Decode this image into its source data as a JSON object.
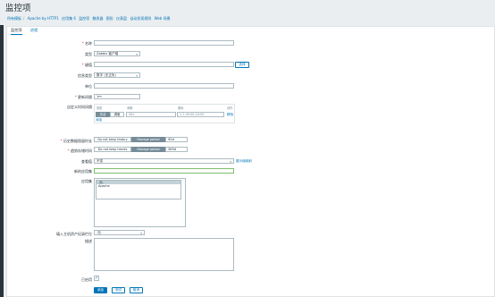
{
  "header": {
    "title": "监控项",
    "breadcrumbs": [
      "所有模板",
      "Apache by HTTP1",
      "应用集 6",
      "监控项",
      "触发器",
      "图形",
      "仪表盘",
      "自动发现规则",
      "Web 场景"
    ]
  },
  "tabs": [
    "监控项",
    "进程"
  ],
  "form": {
    "name_label": "名称",
    "type_label": "类型",
    "type_value": "Zabbix 客户端",
    "key_label": "键值",
    "key_select_button": "选择",
    "info_type_label": "信息类型",
    "info_type_value": "数字 (无正负)",
    "units_label": "单位",
    "interval_label": "更新间隔",
    "interval_value": "1m",
    "custom_intervals_label": "自定义时间间隔",
    "custom_intervals": {
      "col_type": "类型",
      "col_interval": "间隔",
      "col_period": "期间",
      "col_action": "动作",
      "seg_flexible": "灵活",
      "seg_scheduling": "调度",
      "interval_placeholder": "50s",
      "period_placeholder": "1-7,00:00-24:00",
      "remove_link": "移除",
      "add_link": "添加"
    },
    "history_label": "历史数据保留时长",
    "history_opt1": "Do not keep history",
    "history_opt2": "Storage period",
    "history_value": "90d",
    "trends_label": "趋势存储时间",
    "trends_opt1": "Do not keep trends",
    "trends_opt2": "Storage period",
    "trends_value": "365d",
    "valuemap_label": "查看值",
    "valuemap_value": "不变",
    "valuemap_link": "展示值映射",
    "new_app_label": "新的应用集",
    "apps_label": "应用集",
    "apps_options": [
      "-无-",
      "Apache"
    ],
    "populate_label": "填入主机资产纪录栏位",
    "populate_value": "-无-",
    "description_label": "描述",
    "enabled_label": "已启用",
    "enabled_mark": "✓"
  },
  "actions": {
    "add": "添加",
    "test": "测试",
    "cancel": "取消"
  }
}
